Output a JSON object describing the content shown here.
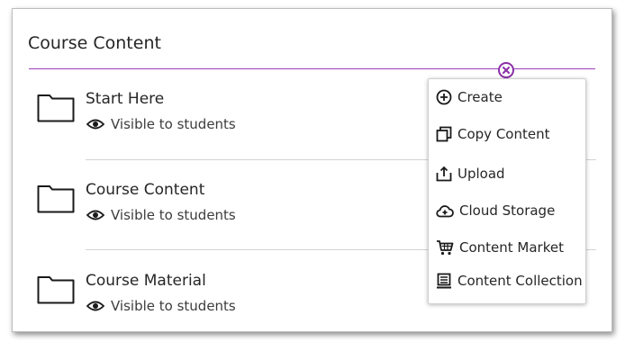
{
  "page": {
    "title": "Course Content"
  },
  "items": [
    {
      "name": "Start Here",
      "visibility": "Visible to students"
    },
    {
      "name": "Course Content",
      "visibility": "Visible to students"
    },
    {
      "name": "Course Material",
      "visibility": "Visible to students"
    }
  ],
  "add_menu": {
    "items": [
      {
        "label": "Create",
        "icon": "plus-circle-icon"
      },
      {
        "label": "Copy Content",
        "icon": "copy-icon"
      },
      {
        "label": "Upload",
        "icon": "upload-icon"
      },
      {
        "label": "Cloud Storage",
        "icon": "cloud-plus-icon"
      },
      {
        "label": "Content Market",
        "icon": "cart-icon"
      },
      {
        "label": "Content Collection",
        "icon": "collection-icon"
      }
    ]
  },
  "colors": {
    "accent": "#8a2fa6",
    "divider": "#9c3fb8",
    "text": "#262626"
  }
}
